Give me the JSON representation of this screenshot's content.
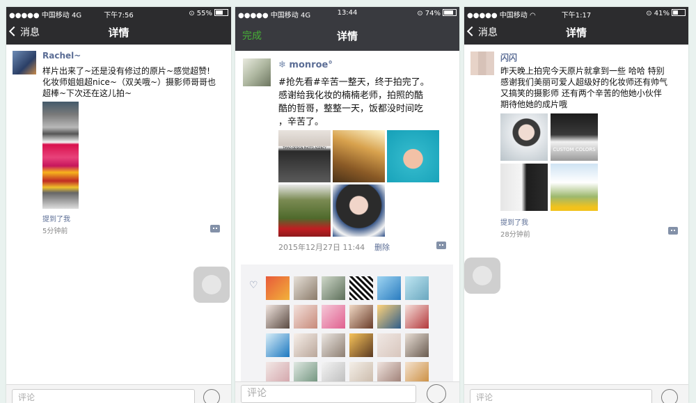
{
  "screens": [
    {
      "status": {
        "left": "●●●●● 中国移动  4G",
        "center": "下午7:56",
        "right": "55%",
        "battery": 0.55
      },
      "nav": {
        "back": "消息",
        "title": "详情"
      },
      "post": {
        "user": "Rachel~",
        "text_lines": [
          "样片出来了~还是没有修过的原片~感觉超赞!",
          "化妆师姐姐超nice~（双关哦~）摄影师哥哥也",
          "超棒~下次还在这儿拍~"
        ],
        "mention": "提到了我",
        "time": "5分钟前"
      },
      "comment_placeholder": "评论"
    },
    {
      "status": {
        "left": "●●●●● 中国移动  4G",
        "center": "13:44",
        "right": "74%",
        "battery": 0.74
      },
      "nav": {
        "done": "完成",
        "title": "详情"
      },
      "post": {
        "user": "monroe°",
        "text_lines": [
          "#抢先看#辛苦一整天，终于拍完了。",
          "感谢给我化妆的楠楠老师，拍照的酷",
          "酷的哲哥，整整一天，饭都没时间吃",
          "，辛苦了。"
        ],
        "time": "2015年12月27日 11:44",
        "delete": "删除",
        "photo_caption": "TAYAO DESIGN PHOTO AGENCY"
      },
      "comment_placeholder": "评论"
    },
    {
      "status": {
        "left": "●●●●● 中国移动  ",
        "center": "下午1:17",
        "right": "41%",
        "battery": 0.41
      },
      "nav": {
        "back": "消息",
        "title": "详情"
      },
      "post": {
        "user": "闪闪",
        "text_lines": [
          "昨天晚上拍完今天原片就拿到一些 哈哈 特别",
          "感谢我们美丽可爱人超级好的化妆师还有帅气",
          "又搞笑的摄影师 还有两个辛苦的他她小伙伴",
          "期待他她的成片哦"
        ],
        "mention": "提到了我",
        "time": "28分钟前",
        "photo_caption": "CUSTOM COLORS"
      },
      "comment_placeholder": "评论"
    }
  ],
  "icons": {
    "back": "chevron-left-icon",
    "comment": "comment-bubble-icon",
    "emoji": "emoji-icon",
    "like": "heart-icon",
    "assist": "assistive-touch-icon",
    "wifi": "wifi-icon",
    "lock": "rotation-lock-icon",
    "battery": "battery-icon"
  },
  "colors": {
    "nav": "#2c2c2e",
    "link": "#5b6d95",
    "done": "#46b036",
    "background": "#e9f2ef"
  }
}
